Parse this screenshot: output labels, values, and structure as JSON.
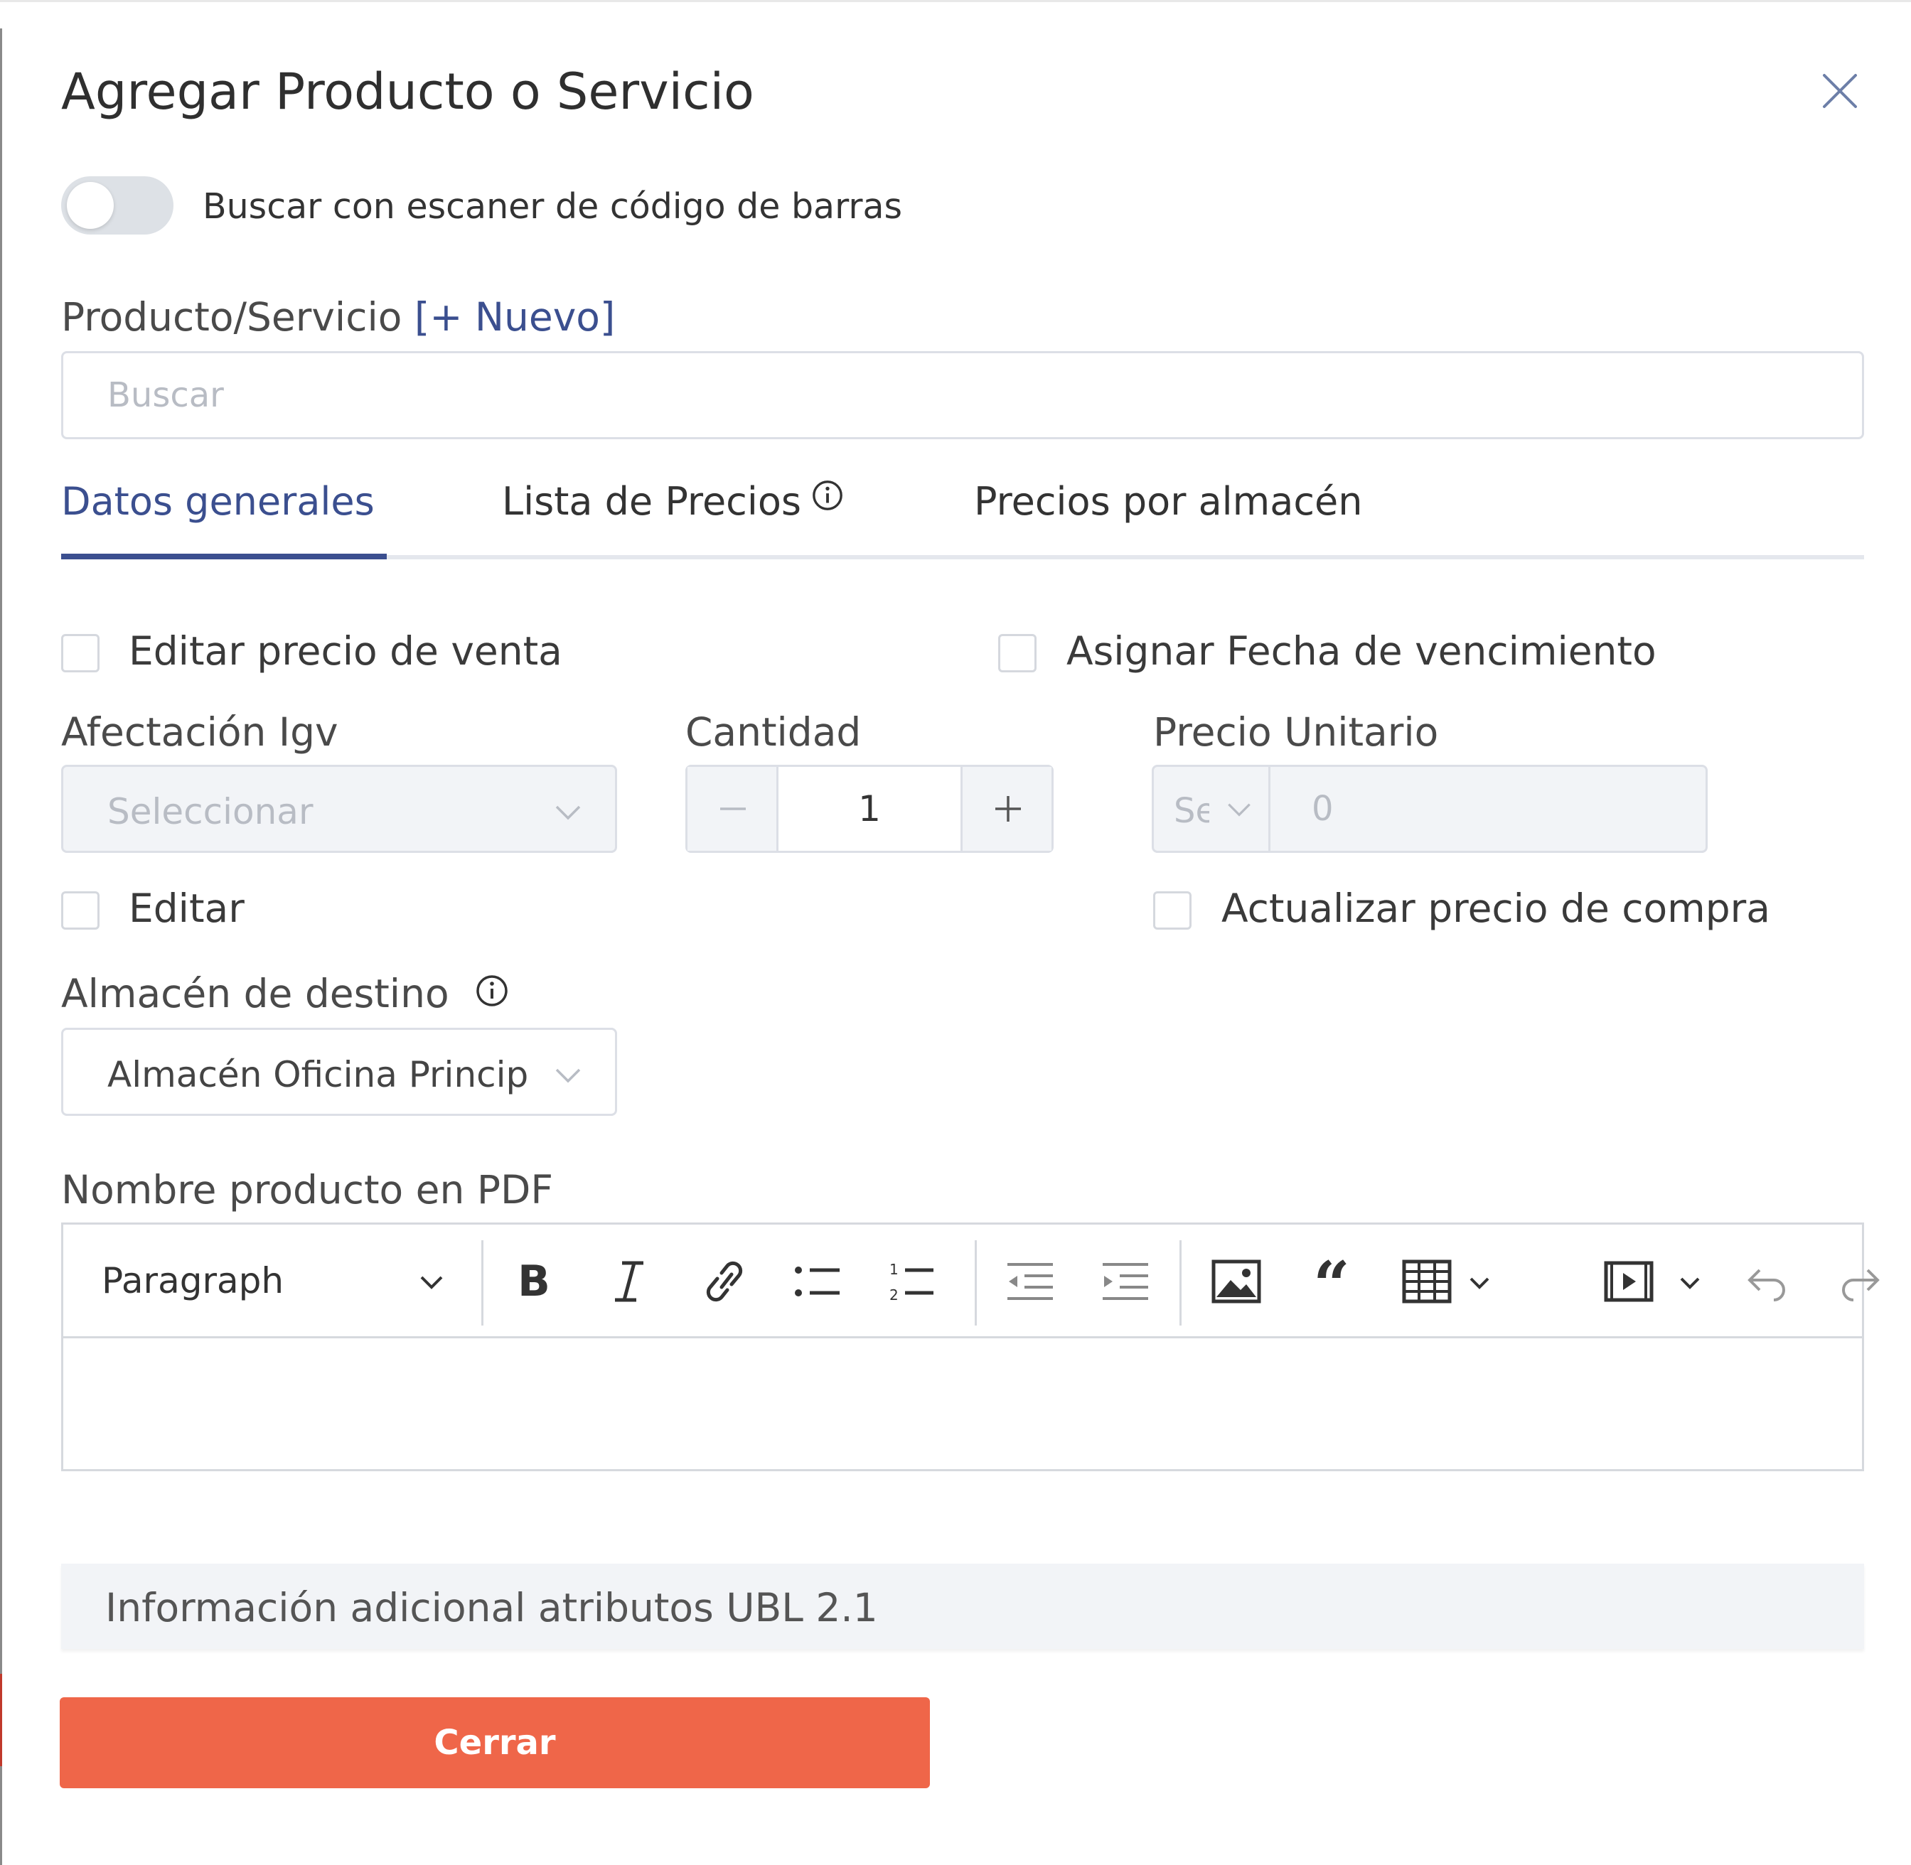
{
  "dialog": {
    "title": "Agregar Producto o Servicio",
    "close_icon": "close-icon"
  },
  "barcode": {
    "label": "Buscar con escaner de código de barras",
    "enabled": false
  },
  "product": {
    "label": "Producto/Servicio",
    "new_link": "[+ Nuevo]",
    "search_placeholder": "Buscar"
  },
  "tabs": [
    {
      "label": "Datos generales",
      "active": true
    },
    {
      "label": "Lista de Precios",
      "active": false,
      "icon": "info-icon"
    },
    {
      "label": "Precios por almacén",
      "active": false
    }
  ],
  "form": {
    "edit_sale_price": "Editar precio de venta",
    "assign_expiry": "Asignar Fecha de vencimiento",
    "igv_label": "Afectación Igv",
    "igv_placeholder": "Seleccionar",
    "quantity_label": "Cantidad",
    "quantity_value": "1",
    "unit_price_label": "Precio Unitario",
    "currency_placeholder": "Seleccionar",
    "unit_price_value": "0",
    "edit": "Editar",
    "update_purchase_price": "Actualizar precio de compra",
    "warehouse_label": "Almacén de destino",
    "warehouse_value": "Almacén Oficina Principal",
    "pdf_name_label": "Nombre producto en PDF"
  },
  "editor": {
    "paragraph_select": "Paragraph",
    "toolbar_icons": [
      "bold-icon",
      "italic-icon",
      "link-icon",
      "bulleted-list-icon",
      "numbered-list-icon",
      "outdent-icon",
      "indent-icon",
      "image-icon",
      "blockquote-icon",
      "table-icon",
      "media-icon",
      "undo-icon",
      "redo-icon"
    ]
  },
  "additional_info": {
    "label": "Información adicional atributos UBL 2.1"
  },
  "footer": {
    "close_label": "Cerrar"
  },
  "colors": {
    "accent": "#3b4f8f",
    "danger_button": "#ef6649",
    "disabled_bg": "#f2f4f7",
    "border": "#dcdfe6"
  }
}
